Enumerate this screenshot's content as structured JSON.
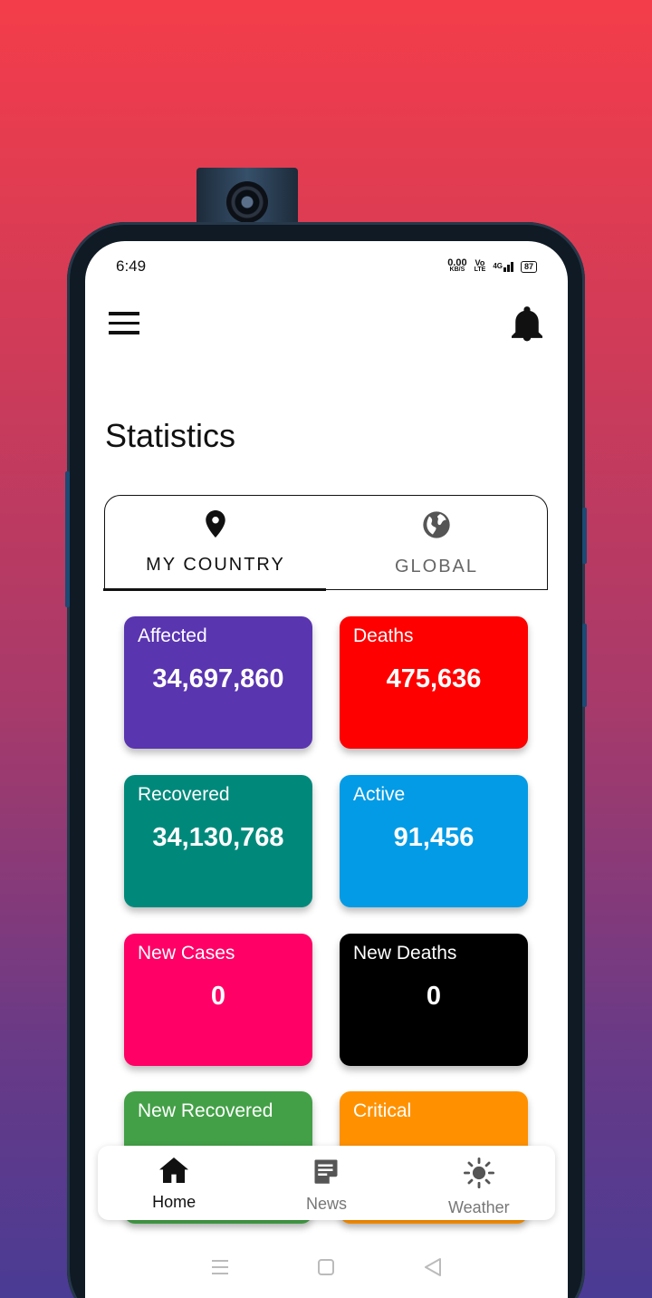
{
  "status_bar": {
    "time": "6:49",
    "net_speed_value": "0.00",
    "net_speed_unit": "KB/S",
    "volte": "Vo",
    "volte_sub": "LTE",
    "signal": "4G",
    "battery": "87"
  },
  "header": {
    "menu_icon": "hamburger-menu-icon",
    "bell_icon": "bell-icon"
  },
  "page": {
    "title": "Statistics"
  },
  "tabs": [
    {
      "label": "MY COUNTRY",
      "icon": "location-pin-icon",
      "active": true
    },
    {
      "label": "GLOBAL",
      "icon": "globe-icon",
      "active": false
    }
  ],
  "stats": [
    {
      "title": "Affected",
      "value": "34,697,860",
      "color": "#5a35b0"
    },
    {
      "title": "Deaths",
      "value": "475,636",
      "color": "#ff0000"
    },
    {
      "title": "Recovered",
      "value": "34,130,768",
      "color": "#00897b"
    },
    {
      "title": "Active",
      "value": "91,456",
      "color": "#039be5"
    },
    {
      "title": "New Cases",
      "value": "0",
      "color": "#ff0066"
    },
    {
      "title": "New Deaths",
      "value": "0",
      "color": "#000000"
    },
    {
      "title": "New Recovered",
      "value": "",
      "color": "#43a047"
    },
    {
      "title": "Critical",
      "value": "",
      "color": "#ff9100"
    }
  ],
  "bottom_nav": [
    {
      "label": "Home",
      "icon": "home-icon",
      "active": true
    },
    {
      "label": "News",
      "icon": "news-icon",
      "active": false
    },
    {
      "label": "Weather",
      "icon": "sun-icon",
      "active": false
    }
  ]
}
